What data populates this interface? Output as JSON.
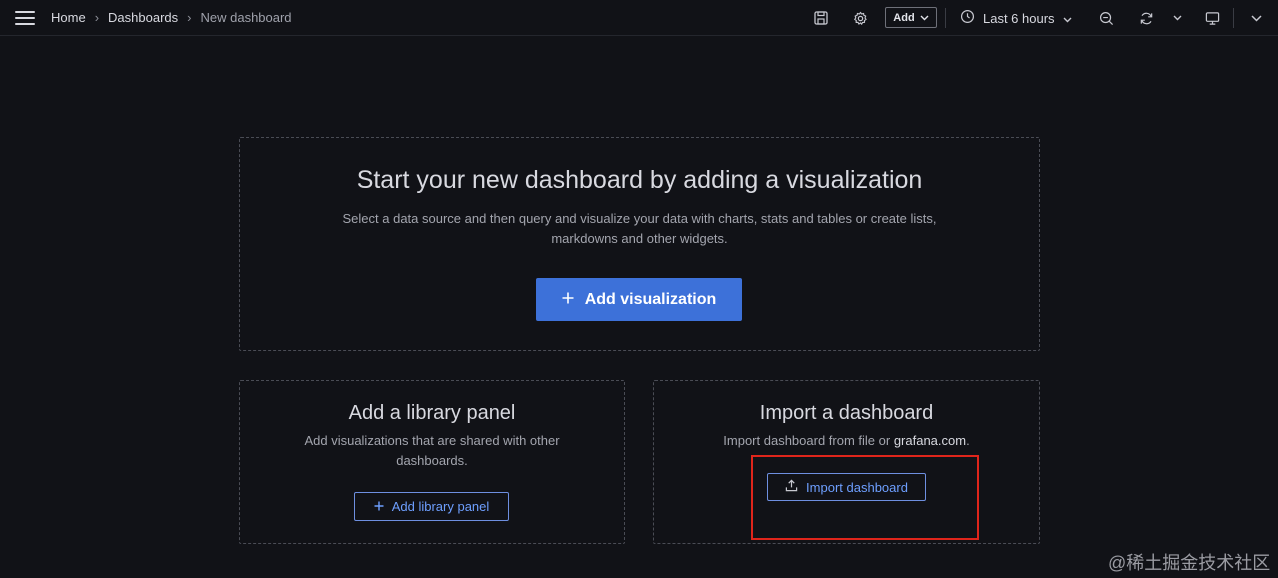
{
  "breadcrumb": {
    "home": "Home",
    "dashboards": "Dashboards",
    "current": "New dashboard",
    "separator": "›"
  },
  "toolbar": {
    "add_label": "Add",
    "time_range": "Last 6 hours"
  },
  "hero": {
    "title": "Start your new dashboard by adding a visualization",
    "description_line1": "Select a data source and then query and visualize your data with charts, stats and tables or create lists,",
    "description_line2": "markdowns and other widgets.",
    "button_label": "Add visualization"
  },
  "library": {
    "title": "Add a library panel",
    "description_line1": "Add visualizations that are shared with other",
    "description_line2": "dashboards.",
    "button_label": "Add library panel"
  },
  "import": {
    "title": "Import a dashboard",
    "description_prefix": "Import dashboard from file or",
    "description_link": "grafana.com",
    "description_suffix": ".",
    "button_label": "Import dashboard"
  },
  "watermark": "@稀土掘金技术社区",
  "colors": {
    "background": "#111217",
    "primary": "#3d71d9",
    "link": "#6e9fff",
    "highlight": "#e0251b"
  }
}
